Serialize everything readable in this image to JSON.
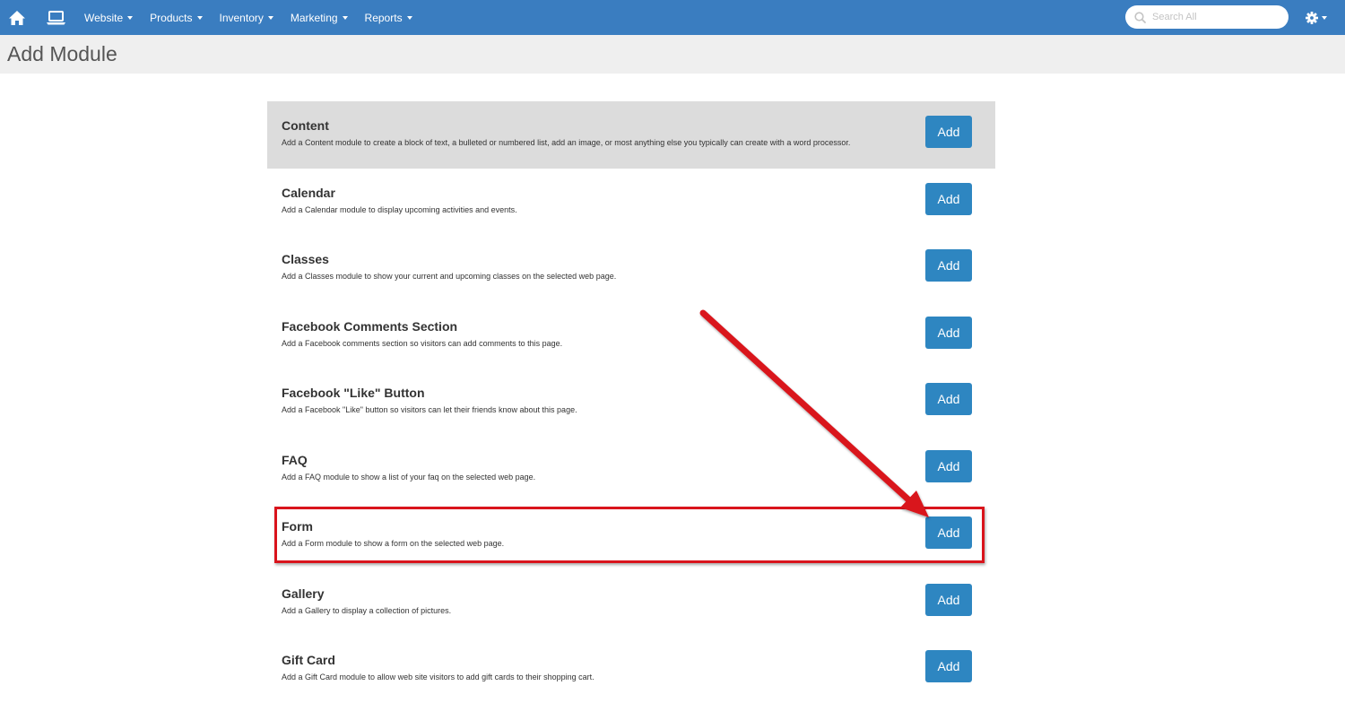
{
  "nav": {
    "home_icon": "home-icon",
    "monitor_icon": "monitor-icon",
    "menus": [
      {
        "label": "Website"
      },
      {
        "label": "Products"
      },
      {
        "label": "Inventory"
      },
      {
        "label": "Marketing"
      },
      {
        "label": "Reports"
      }
    ],
    "search": {
      "placeholder": "Search All",
      "value": ""
    },
    "settings_icon": "gear-icon"
  },
  "page": {
    "title": "Add Module"
  },
  "modules": [
    {
      "title": "Content",
      "description": "Add a Content module to create a block of text, a bulleted or numbered list, add an image, or most anything else you typically can create with a word processor.",
      "button": "Add"
    },
    {
      "title": "Calendar",
      "description": "Add a Calendar module to display upcoming activities and events.",
      "button": "Add"
    },
    {
      "title": "Classes",
      "description": "Add a Classes module to show your current and upcoming classes on the selected web page.",
      "button": "Add"
    },
    {
      "title": "Facebook Comments Section",
      "description": "Add a Facebook comments section so visitors can add comments to this page.",
      "button": "Add"
    },
    {
      "title": "Facebook \"Like\" Button",
      "description": "Add a Facebook \"Like\" button so visitors can let their friends know about this page.",
      "button": "Add"
    },
    {
      "title": "FAQ",
      "description": "Add a FAQ module to show a list of your faq on the selected web page.",
      "button": "Add"
    },
    {
      "title": "Form",
      "description": "Add a Form module to show a form on the selected web page.",
      "button": "Add"
    },
    {
      "title": "Gallery",
      "description": "Add a Gallery to display a collection of pictures.",
      "button": "Add"
    },
    {
      "title": "Gift Card",
      "description": "Add a Gift Card module to allow web site visitors to add gift cards to their shopping cart.",
      "button": "Add"
    }
  ],
  "colors": {
    "nav_bg": "#3a7dc0",
    "button": "#2e86c1",
    "highlight_row": "#dcdcdc",
    "annotation": "#d9141c"
  }
}
